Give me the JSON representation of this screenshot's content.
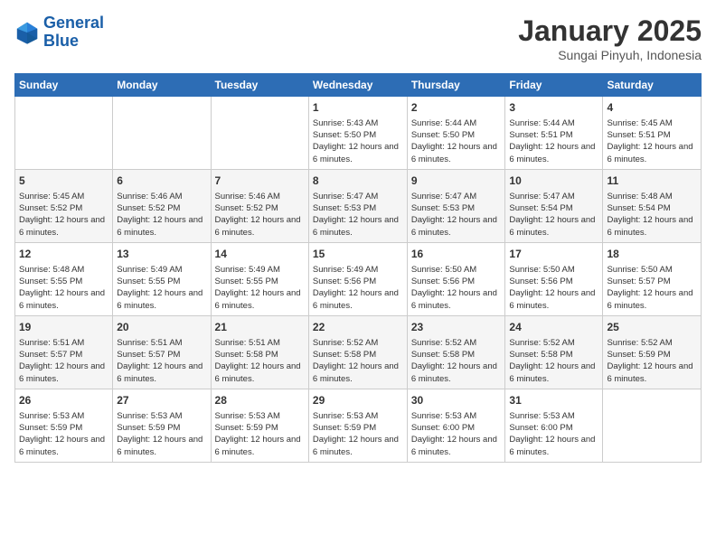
{
  "header": {
    "logo_line1": "General",
    "logo_line2": "Blue",
    "title": "January 2025",
    "subtitle": "Sungai Pinyuh, Indonesia"
  },
  "weekdays": [
    "Sunday",
    "Monday",
    "Tuesday",
    "Wednesday",
    "Thursday",
    "Friday",
    "Saturday"
  ],
  "weeks": [
    [
      {
        "num": "",
        "info": ""
      },
      {
        "num": "",
        "info": ""
      },
      {
        "num": "",
        "info": ""
      },
      {
        "num": "1",
        "info": "Sunrise: 5:43 AM\nSunset: 5:50 PM\nDaylight: 12 hours and 6 minutes."
      },
      {
        "num": "2",
        "info": "Sunrise: 5:44 AM\nSunset: 5:50 PM\nDaylight: 12 hours and 6 minutes."
      },
      {
        "num": "3",
        "info": "Sunrise: 5:44 AM\nSunset: 5:51 PM\nDaylight: 12 hours and 6 minutes."
      },
      {
        "num": "4",
        "info": "Sunrise: 5:45 AM\nSunset: 5:51 PM\nDaylight: 12 hours and 6 minutes."
      }
    ],
    [
      {
        "num": "5",
        "info": "Sunrise: 5:45 AM\nSunset: 5:52 PM\nDaylight: 12 hours and 6 minutes."
      },
      {
        "num": "6",
        "info": "Sunrise: 5:46 AM\nSunset: 5:52 PM\nDaylight: 12 hours and 6 minutes."
      },
      {
        "num": "7",
        "info": "Sunrise: 5:46 AM\nSunset: 5:52 PM\nDaylight: 12 hours and 6 minutes."
      },
      {
        "num": "8",
        "info": "Sunrise: 5:47 AM\nSunset: 5:53 PM\nDaylight: 12 hours and 6 minutes."
      },
      {
        "num": "9",
        "info": "Sunrise: 5:47 AM\nSunset: 5:53 PM\nDaylight: 12 hours and 6 minutes."
      },
      {
        "num": "10",
        "info": "Sunrise: 5:47 AM\nSunset: 5:54 PM\nDaylight: 12 hours and 6 minutes."
      },
      {
        "num": "11",
        "info": "Sunrise: 5:48 AM\nSunset: 5:54 PM\nDaylight: 12 hours and 6 minutes."
      }
    ],
    [
      {
        "num": "12",
        "info": "Sunrise: 5:48 AM\nSunset: 5:55 PM\nDaylight: 12 hours and 6 minutes."
      },
      {
        "num": "13",
        "info": "Sunrise: 5:49 AM\nSunset: 5:55 PM\nDaylight: 12 hours and 6 minutes."
      },
      {
        "num": "14",
        "info": "Sunrise: 5:49 AM\nSunset: 5:55 PM\nDaylight: 12 hours and 6 minutes."
      },
      {
        "num": "15",
        "info": "Sunrise: 5:49 AM\nSunset: 5:56 PM\nDaylight: 12 hours and 6 minutes."
      },
      {
        "num": "16",
        "info": "Sunrise: 5:50 AM\nSunset: 5:56 PM\nDaylight: 12 hours and 6 minutes."
      },
      {
        "num": "17",
        "info": "Sunrise: 5:50 AM\nSunset: 5:56 PM\nDaylight: 12 hours and 6 minutes."
      },
      {
        "num": "18",
        "info": "Sunrise: 5:50 AM\nSunset: 5:57 PM\nDaylight: 12 hours and 6 minutes."
      }
    ],
    [
      {
        "num": "19",
        "info": "Sunrise: 5:51 AM\nSunset: 5:57 PM\nDaylight: 12 hours and 6 minutes."
      },
      {
        "num": "20",
        "info": "Sunrise: 5:51 AM\nSunset: 5:57 PM\nDaylight: 12 hours and 6 minutes."
      },
      {
        "num": "21",
        "info": "Sunrise: 5:51 AM\nSunset: 5:58 PM\nDaylight: 12 hours and 6 minutes."
      },
      {
        "num": "22",
        "info": "Sunrise: 5:52 AM\nSunset: 5:58 PM\nDaylight: 12 hours and 6 minutes."
      },
      {
        "num": "23",
        "info": "Sunrise: 5:52 AM\nSunset: 5:58 PM\nDaylight: 12 hours and 6 minutes."
      },
      {
        "num": "24",
        "info": "Sunrise: 5:52 AM\nSunset: 5:58 PM\nDaylight: 12 hours and 6 minutes."
      },
      {
        "num": "25",
        "info": "Sunrise: 5:52 AM\nSunset: 5:59 PM\nDaylight: 12 hours and 6 minutes."
      }
    ],
    [
      {
        "num": "26",
        "info": "Sunrise: 5:53 AM\nSunset: 5:59 PM\nDaylight: 12 hours and 6 minutes."
      },
      {
        "num": "27",
        "info": "Sunrise: 5:53 AM\nSunset: 5:59 PM\nDaylight: 12 hours and 6 minutes."
      },
      {
        "num": "28",
        "info": "Sunrise: 5:53 AM\nSunset: 5:59 PM\nDaylight: 12 hours and 6 minutes."
      },
      {
        "num": "29",
        "info": "Sunrise: 5:53 AM\nSunset: 5:59 PM\nDaylight: 12 hours and 6 minutes."
      },
      {
        "num": "30",
        "info": "Sunrise: 5:53 AM\nSunset: 6:00 PM\nDaylight: 12 hours and 6 minutes."
      },
      {
        "num": "31",
        "info": "Sunrise: 5:53 AM\nSunset: 6:00 PM\nDaylight: 12 hours and 6 minutes."
      },
      {
        "num": "",
        "info": ""
      }
    ]
  ]
}
